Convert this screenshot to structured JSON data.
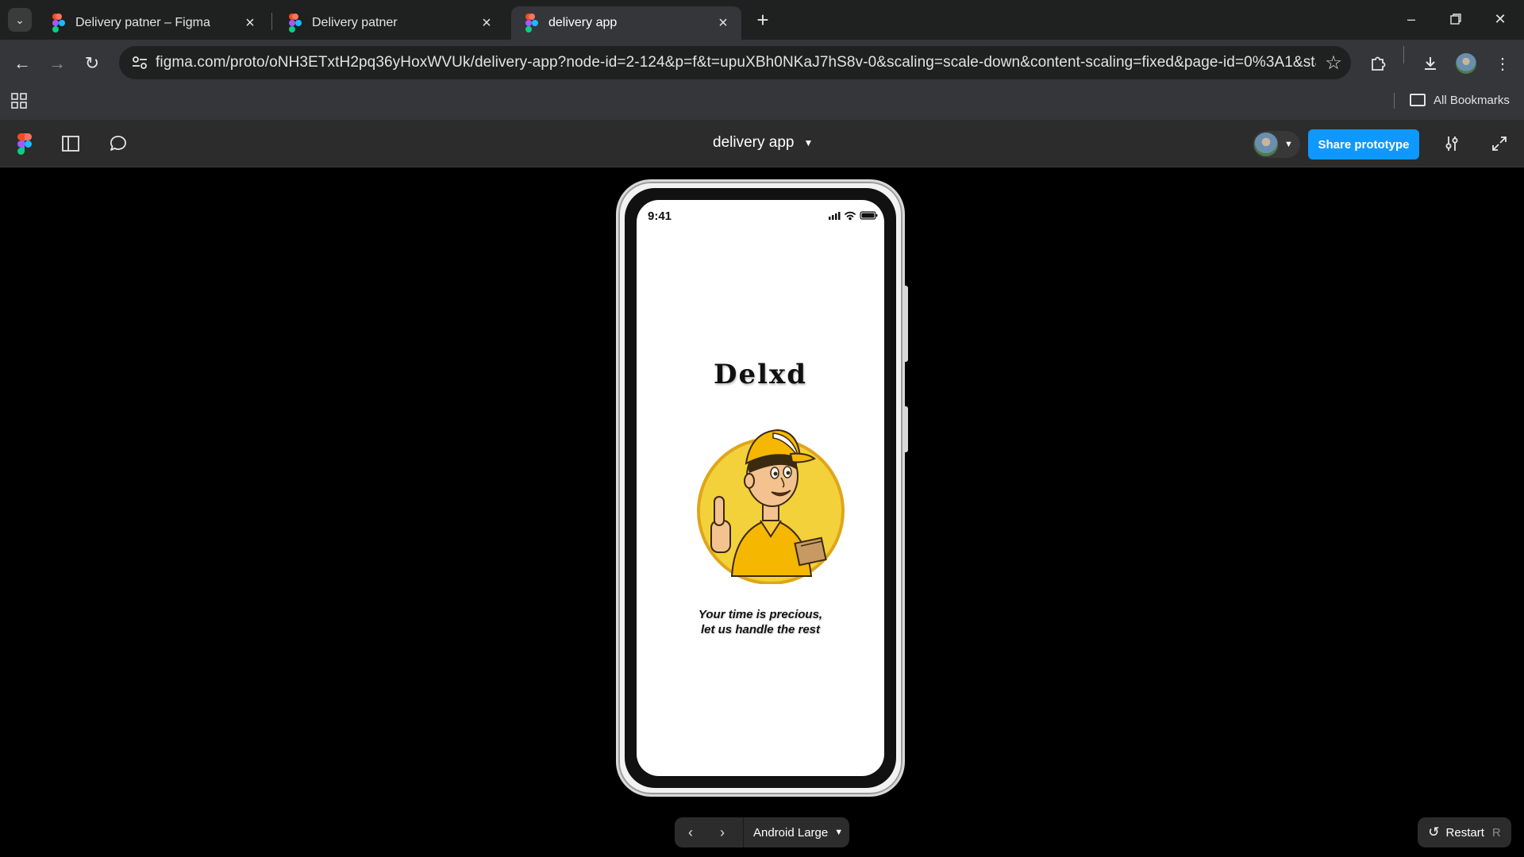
{
  "browser": {
    "tabs": [
      {
        "title": "Delivery patner – Figma",
        "active": false
      },
      {
        "title": "Delivery patner",
        "active": false
      },
      {
        "title": "delivery app",
        "active": true
      }
    ],
    "url": "figma.com/proto/oNH3ETxtH2pq36yHoxWVUk/delivery-app?node-id=2-124&p=f&t=upuXBh0NKaJ7hS8v-0&scaling=scale-down&content-scaling=fixed&page-id=0%3A1&starting-poi...",
    "bookmarks_label": "All Bookmarks"
  },
  "figma": {
    "file_title": "delivery app",
    "share_label": "Share prototype",
    "brand_color": "#0d99ff"
  },
  "app_screen": {
    "status_time": "9:41",
    "brand_name": "Delxd",
    "tagline_line1": "Your time is precious,",
    "tagline_line2": "let us handle the rest",
    "mascot": "delivery-man-thumbs-up-illustration"
  },
  "controls": {
    "device_label": "Android Large",
    "restart_label": "Restart",
    "restart_shortcut": "R"
  }
}
